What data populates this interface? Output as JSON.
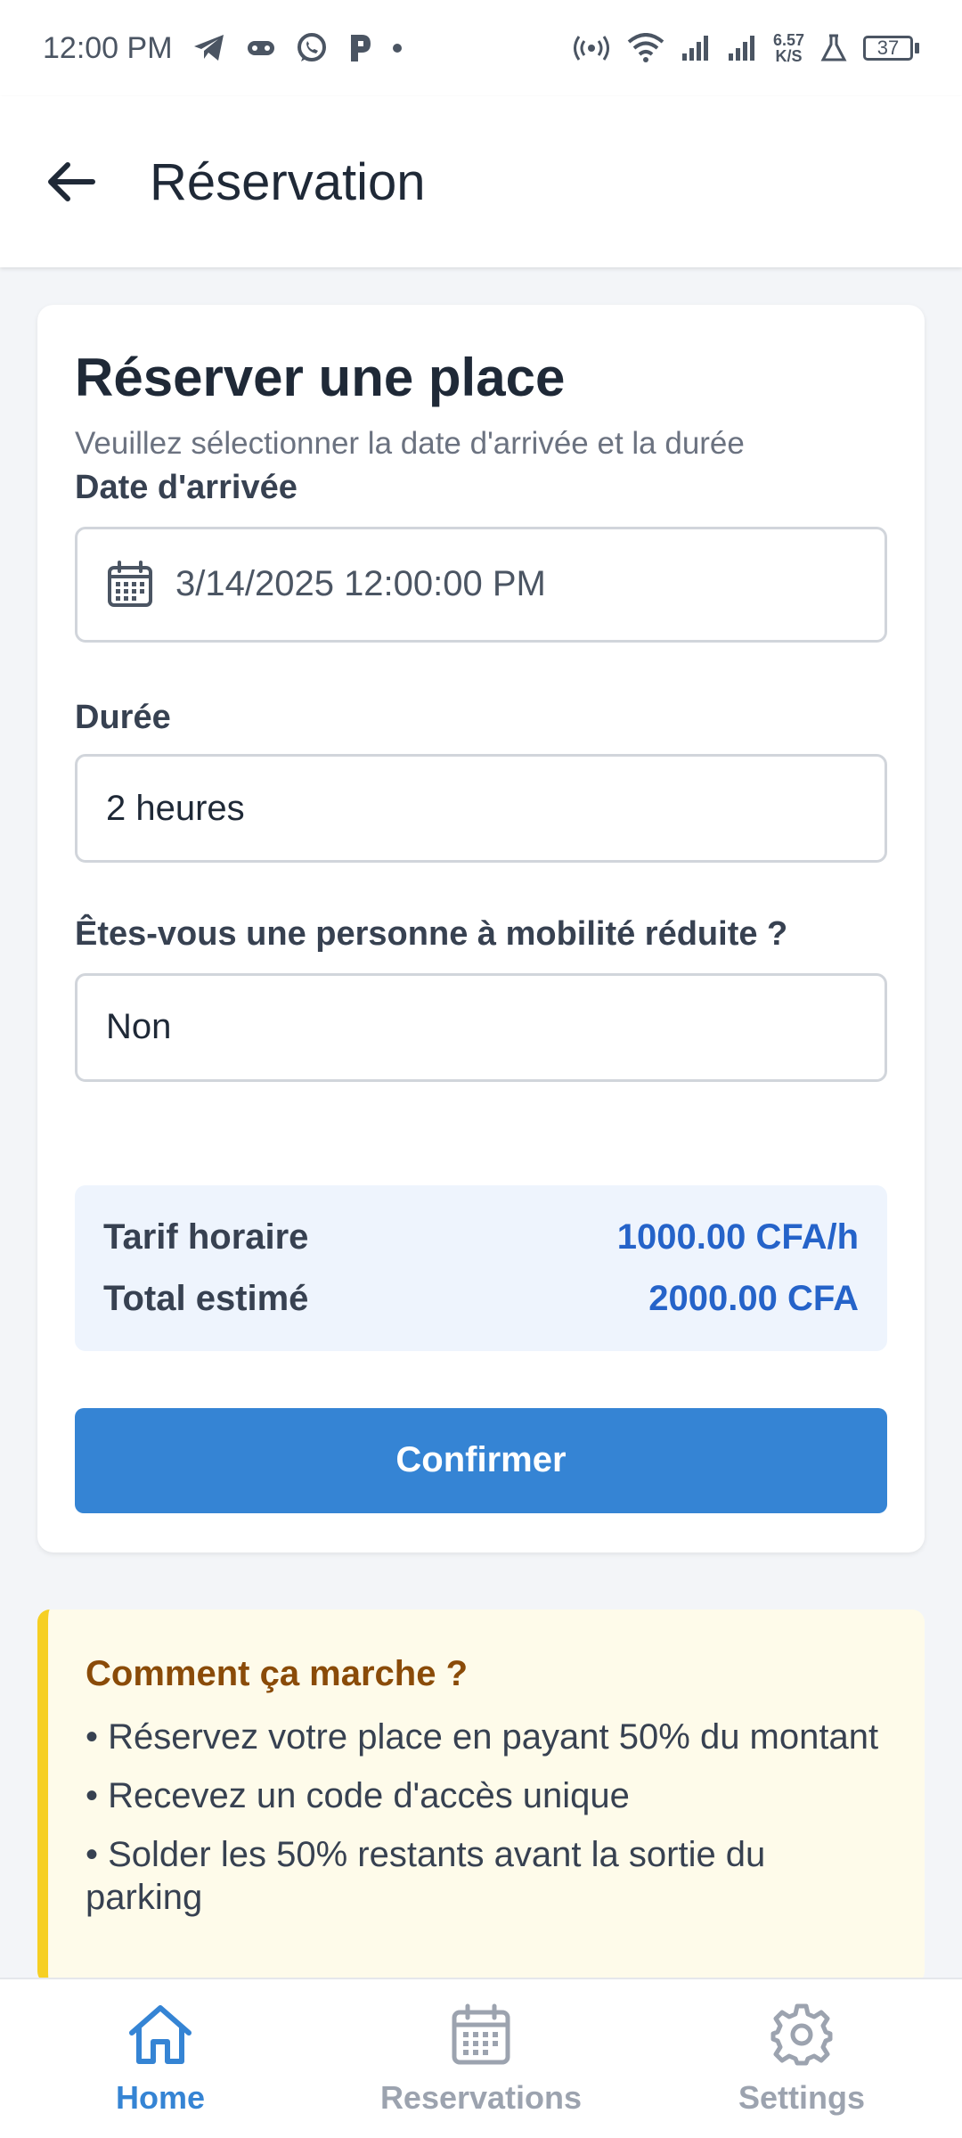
{
  "status_bar": {
    "time": "12:00 PM",
    "net_speed_value": "6.57",
    "net_speed_unit": "K/S",
    "battery": "37",
    "icons": [
      "telegram-icon",
      "game-controller-icon",
      "whatsapp-icon",
      "p-app-icon",
      "dot-icon",
      "hotspot-icon",
      "wifi-icon",
      "signal-icon",
      "signal-icon",
      "lab-icon",
      "battery-icon"
    ]
  },
  "app_bar": {
    "title": "Réservation",
    "back_icon": "arrow-left-icon"
  },
  "form": {
    "title": "Réserver une place",
    "subtitle": "Veuillez sélectionner la date d'arrivée et la durée",
    "date_label": "Date d'arrivée",
    "date_value": "3/14/2025 12:00:00 PM",
    "date_icon": "calendar-icon",
    "duree_label": "Durée",
    "duree_value": "2 heures",
    "pmr_label": "Êtes-vous une personne à mobilité réduite ?",
    "pmr_value": "Non"
  },
  "pricing": {
    "hourly_label": "Tarif horaire",
    "hourly_value": "1000.00 CFA/h",
    "total_label": "Total estimé",
    "total_value": "2000.00 CFA"
  },
  "confirm_label": "Confirmer",
  "info": {
    "title": "Comment ça marche ?",
    "items": [
      "• Réservez votre place en payant 50% du montant",
      "• Recevez un code d'accès unique",
      "• Solder les 50% restants avant la sortie du parking"
    ]
  },
  "nav": {
    "items": [
      {
        "label": "Home",
        "icon": "home-icon",
        "active": true
      },
      {
        "label": "Reservations",
        "icon": "calendar-icon",
        "active": false
      },
      {
        "label": "Settings",
        "icon": "gear-icon",
        "active": false
      }
    ]
  },
  "colors": {
    "primary": "#3584d4",
    "price_text": "#2563c9",
    "info_border": "#f6cf23",
    "info_title": "#8a4b08",
    "info_bg": "#fefbea",
    "tarif_bg": "#eef4fd"
  }
}
